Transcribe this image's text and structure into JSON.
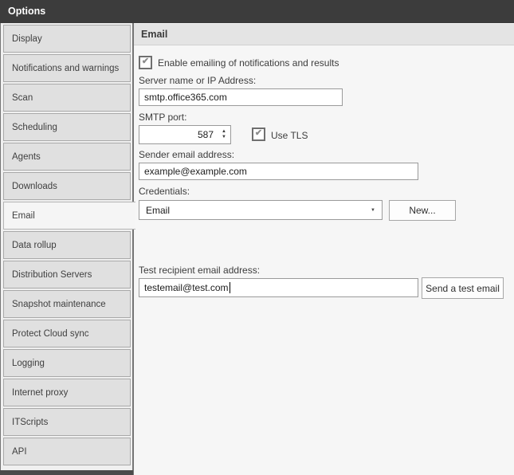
{
  "window": {
    "title": "Options"
  },
  "sidebar": {
    "items": [
      {
        "label": "Display",
        "selected": false
      },
      {
        "label": "Notifications and warnings",
        "selected": false
      },
      {
        "label": "Scan",
        "selected": false
      },
      {
        "label": "Scheduling",
        "selected": false
      },
      {
        "label": "Agents",
        "selected": false
      },
      {
        "label": "Downloads",
        "selected": false
      },
      {
        "label": "Email",
        "selected": true
      },
      {
        "label": "Data rollup",
        "selected": false
      },
      {
        "label": "Distribution Servers",
        "selected": false
      },
      {
        "label": "Snapshot maintenance",
        "selected": false
      },
      {
        "label": "Protect Cloud sync",
        "selected": false
      },
      {
        "label": "Logging",
        "selected": false
      },
      {
        "label": "Internet proxy",
        "selected": false
      },
      {
        "label": "ITScripts",
        "selected": false
      },
      {
        "label": "API",
        "selected": false
      }
    ]
  },
  "panel": {
    "header": "Email",
    "enable": {
      "label": "Enable emailing of notifications and results",
      "checked": true
    },
    "server": {
      "label": "Server name or IP Address:",
      "value": "smtp.office365.com"
    },
    "smtp_port": {
      "label": "SMTP port:",
      "value": "587"
    },
    "use_tls": {
      "label": "Use TLS",
      "checked": true
    },
    "sender": {
      "label": "Sender email address:",
      "value": "example@example.com"
    },
    "credentials": {
      "label": "Credentials:",
      "selected_option": "Email",
      "new_button_label": "New..."
    },
    "test_recipient": {
      "label": "Test recipient email address:",
      "value": "testemail@test.com",
      "send_button_label": "Send a test email"
    }
  },
  "icons": {
    "checkmark": "✔",
    "spinner_up": "▲",
    "spinner_down": "▼",
    "dropdown_arrow": "▼"
  },
  "colors": {
    "titlebar_bg": "#3c3c3c",
    "titlebar_text": "#ffffff",
    "sidebar_bg": "#f0f0f0",
    "tab_bg": "#e0e0e0",
    "tab_selected_bg": "#f5f5f5",
    "tab_border": "#a9a9a9",
    "separator": "#757575",
    "panel_header_bg": "#e4e4e4",
    "content_bg": "#f6f6f6",
    "input_border": "#9a9a9a",
    "check_color": "#8c8c8c"
  }
}
